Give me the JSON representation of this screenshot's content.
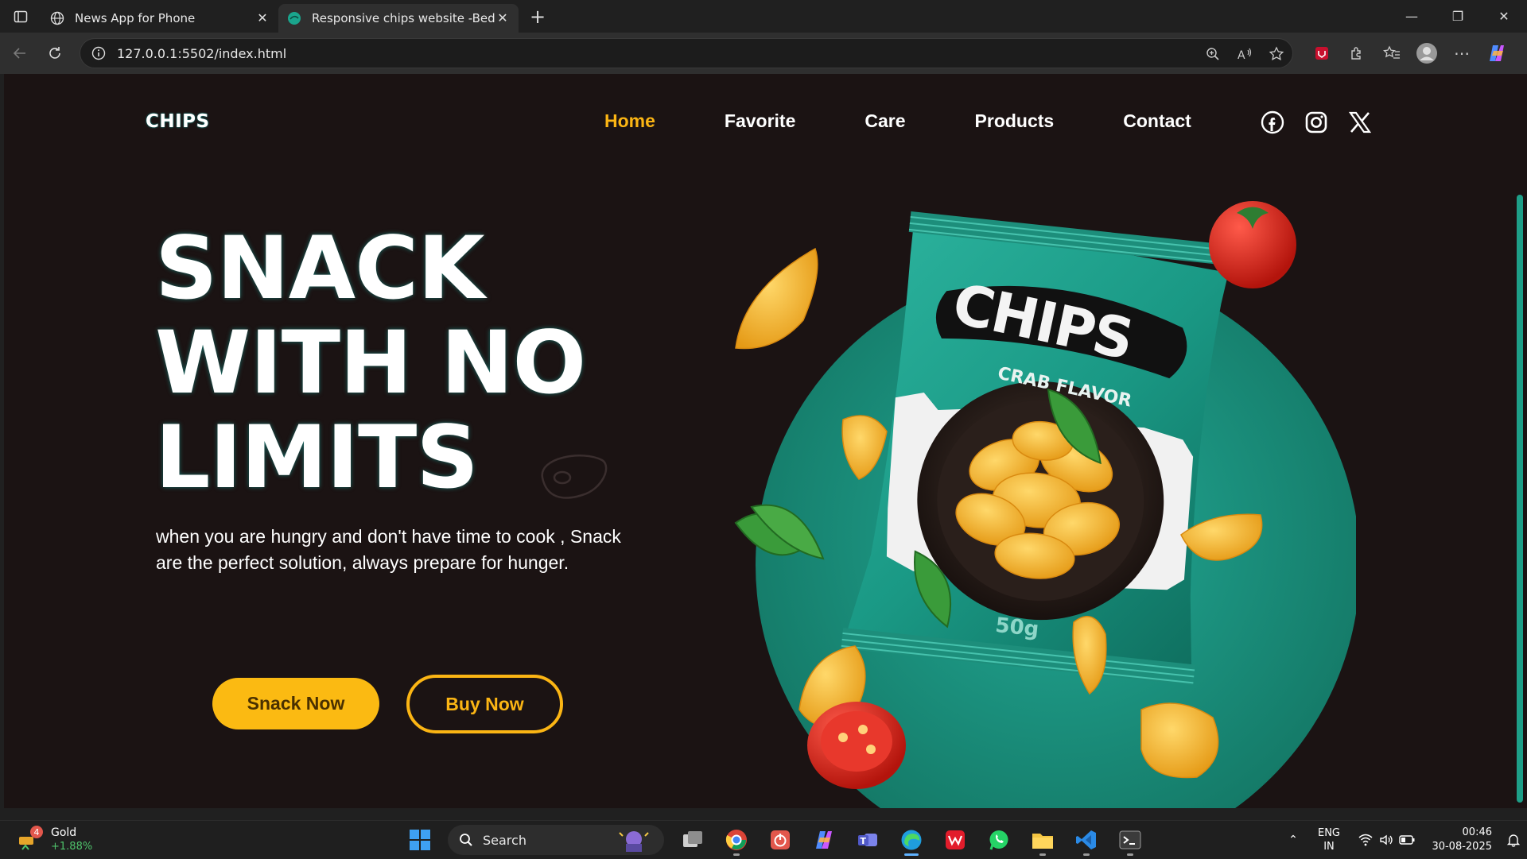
{
  "browser": {
    "tabs": [
      {
        "title": "News App for Phone",
        "active": false
      },
      {
        "title": "Responsive chips website -Bedimcode",
        "active": true
      }
    ],
    "address": "127.0.0.1:5502/index.html"
  },
  "page": {
    "logo": "CHIPS",
    "nav": [
      {
        "label": "Home",
        "active": true
      },
      {
        "label": "Favorite",
        "active": false
      },
      {
        "label": "Care",
        "active": false
      },
      {
        "label": "Products",
        "active": false
      },
      {
        "label": "Contact",
        "active": false
      }
    ],
    "socials": [
      "facebook-icon",
      "instagram-icon",
      "x-icon"
    ],
    "hero": {
      "title_lines": [
        "SNACK",
        "WITH NO",
        "LIMITS"
      ],
      "description": "when you are hungry and don't have time to cook , Snack are the perfect solution, always prepare for hunger.",
      "primary_button": "Snack Now",
      "secondary_button": "Buy Now"
    },
    "bag": {
      "brand": "CHIPS",
      "flavor": "CRAB FLAVOR",
      "weight": "50g"
    },
    "colors": {
      "background": "#1b1313",
      "accent": "#fbb514",
      "teal": "#1a9f8b"
    }
  },
  "taskbar": {
    "widget": {
      "title": "Gold",
      "change": "+1.88%",
      "badge": "4"
    },
    "search_placeholder": "Search",
    "apps": [
      "windows-start-icon",
      "task-view-icon",
      "chrome-icon",
      "power-app-icon",
      "copilot-icon",
      "teams-icon",
      "edge-icon",
      "wps-office-icon",
      "whatsapp-icon",
      "file-explorer-icon",
      "vscode-icon",
      "terminal-icon"
    ],
    "lang": [
      "ENG",
      "IN"
    ],
    "time": "00:46",
    "date": "30-08-2025"
  }
}
